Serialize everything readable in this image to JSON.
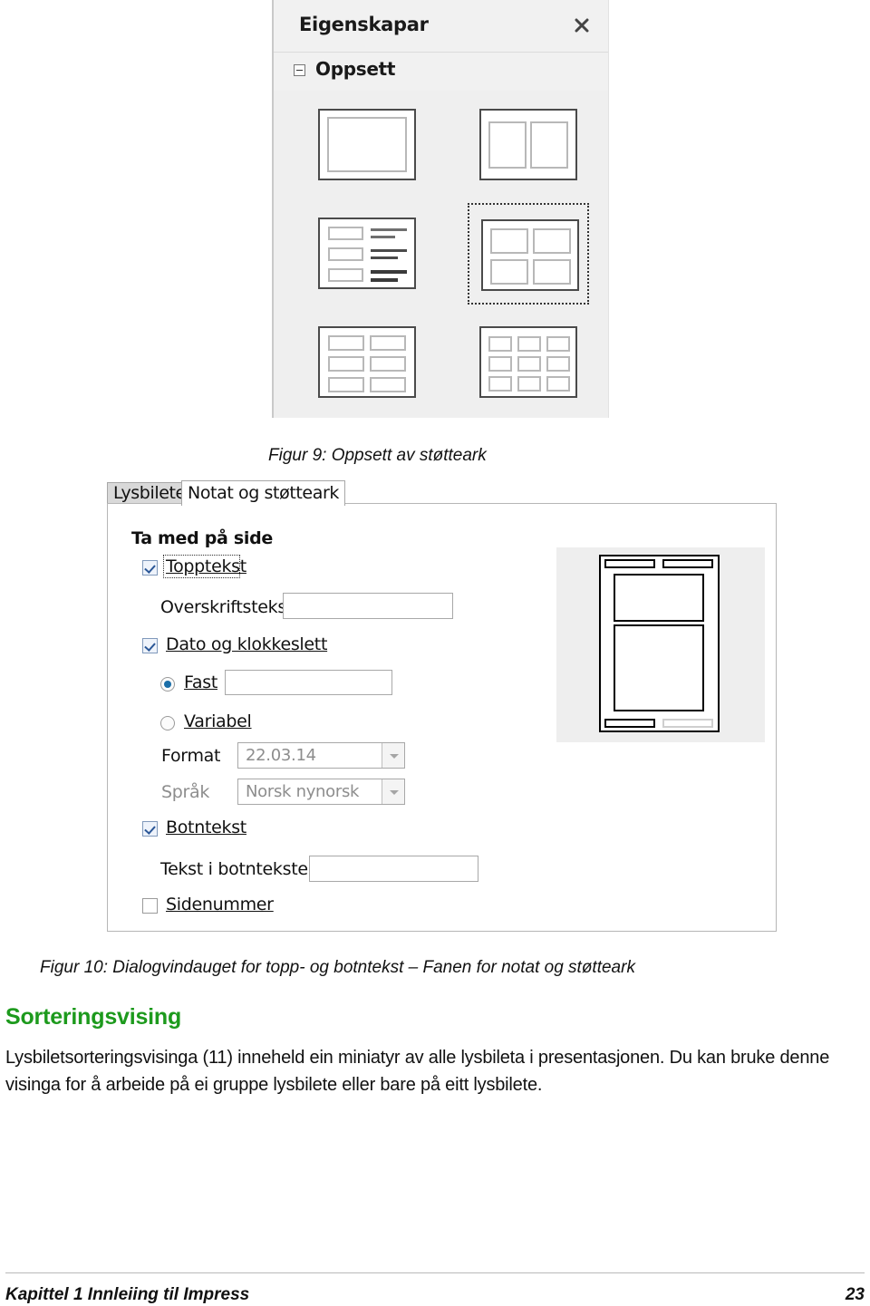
{
  "figure9": {
    "panel": {
      "title": "Eigenskapar",
      "close_icon": "close-icon",
      "section": {
        "label": "Oppsett",
        "expander_state": "expanded"
      },
      "layouts": [
        {
          "id": "blank",
          "name": "Blank slide",
          "selected": false
        },
        {
          "id": "two-content",
          "name": "Two content panes",
          "selected": false
        },
        {
          "id": "list-text",
          "name": "List with text lines",
          "selected": false
        },
        {
          "id": "four-content",
          "name": "Four content panes",
          "selected": true
        },
        {
          "id": "six-content",
          "name": "Six content panes",
          "selected": false
        },
        {
          "id": "nine-content",
          "name": "Nine content panes",
          "selected": false
        }
      ]
    },
    "caption": "Figur 9: Oppsett av støtteark"
  },
  "figure10": {
    "tabs": [
      {
        "label": "Lysbilete",
        "active": false
      },
      {
        "label": "Notat og støtteark",
        "active": true
      }
    ],
    "group_title": "Ta med på side",
    "controls": {
      "header_checkbox": {
        "label": "Topptekst",
        "checked": true,
        "focused": true
      },
      "header_text_label": "Overskriftstekst:",
      "header_text_value": "",
      "date_checkbox": {
        "label": "Dato og klokkeslett",
        "checked": true
      },
      "fixed_radio": {
        "label": "Fast",
        "selected": true
      },
      "fixed_text_value": "",
      "variable_radio": {
        "label": "Variabel",
        "selected": false
      },
      "format_label": "Format",
      "format_value": "22.03.14",
      "language_label": "Språk",
      "language_value": "Norsk nynorsk",
      "footer_checkbox": {
        "label": "Botntekst",
        "checked": true
      },
      "footer_text_label": "Tekst i botnteksten:",
      "footer_text_value": "",
      "slidenumber_checkbox": {
        "label": "Sidenummer",
        "checked": false
      }
    },
    "caption": "Figur 10: Dialogvindauget for topp- og botntekst – Fanen for notat og støtteark"
  },
  "content": {
    "heading": "Sorteringsvising",
    "paragraph": "Lysbiletsorteringsvisinga (11) inneheld ein miniatyr av alle lysbileta i presentasjonen. Du kan bruke denne visinga for å arbeide på ei gruppe lysbilete eller bare på eitt lysbilete."
  },
  "footer": {
    "left": "Kapittel 1   Innleiing til Impress",
    "page_number": "23"
  },
  "colors": {
    "heading_green": "#1D9A1D",
    "panel_background": "#F1F1F1",
    "layouts_background": "#EFEFEF",
    "checkbox_check": "#2B5797",
    "radio_dot": "#1B6EA8"
  }
}
